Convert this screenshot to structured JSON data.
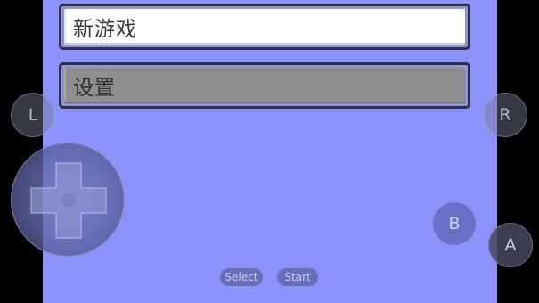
{
  "menu": {
    "items": [
      {
        "label": "新游戏",
        "selected": true
      },
      {
        "label": "设置",
        "selected": false
      }
    ]
  },
  "controls": {
    "l_label": "L",
    "r_label": "R",
    "a_label": "A",
    "b_label": "B",
    "select_label": "Select",
    "start_label": "Start",
    "dpad_icon": "dpad-cross-icon"
  },
  "colors": {
    "screen_background": "#8b92fb",
    "selected_item": "#ffffff",
    "unselected_item": "#8f8f8f",
    "item_border": "#2f3046"
  }
}
